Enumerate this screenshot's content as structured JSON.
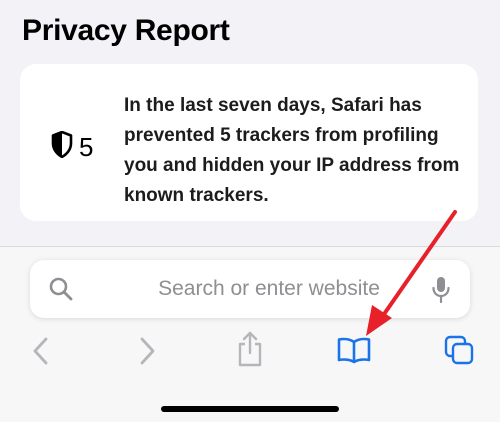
{
  "page": {
    "title": "Privacy Report"
  },
  "privacy_card": {
    "icon": "shield-half-icon",
    "tracker_count": "5",
    "message": "In the last seven days, Safari has prevented 5 trackers from profiling you and hidden your IP address from known trackers."
  },
  "address_bar": {
    "placeholder": "Search or enter website",
    "search_icon": "magnifier-icon",
    "mic_icon": "microphone-icon"
  },
  "toolbar": {
    "buttons": [
      {
        "name": "back",
        "icon": "chevron-left-icon",
        "enabled": false
      },
      {
        "name": "forward",
        "icon": "chevron-right-icon",
        "enabled": false
      },
      {
        "name": "share",
        "icon": "share-icon",
        "enabled": false
      },
      {
        "name": "bookmarks",
        "icon": "book-icon",
        "enabled": true
      },
      {
        "name": "tabs",
        "icon": "tabs-icon",
        "enabled": true
      }
    ]
  },
  "colors": {
    "accent": "#1a73e8",
    "disabled": "#b5b5ba",
    "annotation_arrow": "#e8202a",
    "background": "#f2f2f7",
    "card": "#ffffff"
  }
}
